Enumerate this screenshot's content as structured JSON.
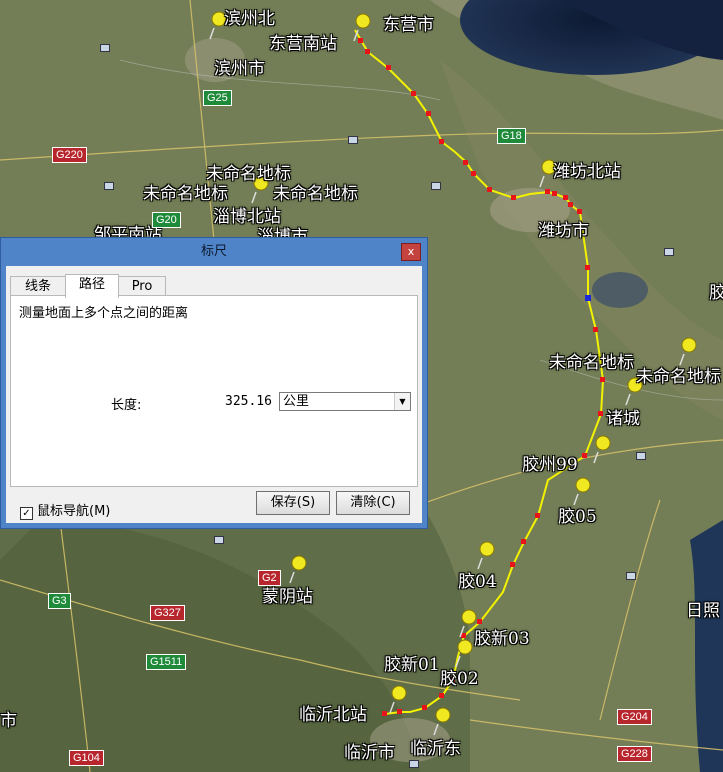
{
  "map": {
    "places": [
      {
        "text": "滨州北"
      },
      {
        "text": "东营市"
      },
      {
        "text": "东营南站"
      },
      {
        "text": "滨州市"
      },
      {
        "text": "潍坊北站"
      },
      {
        "text": "未命名地标"
      },
      {
        "text": "未命名地标"
      },
      {
        "text": "未命名地标"
      },
      {
        "text": "淄博北站"
      },
      {
        "text": "邹平南站"
      },
      {
        "text": "淄博市"
      },
      {
        "text": "潍坊市"
      },
      {
        "text": "胶"
      },
      {
        "text": "未命名地标"
      },
      {
        "text": "未命名地标"
      },
      {
        "text": "诸城"
      },
      {
        "text": "胶州99"
      },
      {
        "text": "胶05"
      },
      {
        "text": "胶04"
      },
      {
        "text": "蒙阴站"
      },
      {
        "text": "胶新03"
      },
      {
        "text": "日照"
      },
      {
        "text": "胶新01"
      },
      {
        "text": "胶02"
      },
      {
        "text": "临沂北站"
      },
      {
        "text": "临沂市"
      },
      {
        "text": "临沂东"
      },
      {
        "text": "市"
      }
    ],
    "shields": [
      {
        "text": "G25",
        "color": "green"
      },
      {
        "text": "G220",
        "color": "red"
      },
      {
        "text": "G18",
        "color": "green"
      },
      {
        "text": "G20",
        "color": "green"
      },
      {
        "text": "G3",
        "color": "green"
      },
      {
        "text": "G327",
        "color": "red"
      },
      {
        "text": "G2",
        "color": "red"
      },
      {
        "text": "G1511",
        "color": "green"
      },
      {
        "text": "G204",
        "color": "red"
      },
      {
        "text": "G104",
        "color": "red"
      },
      {
        "text": "G228",
        "color": "red"
      }
    ]
  },
  "dialog": {
    "title": "标尺",
    "close": "x",
    "tabs": [
      "线条",
      "路径",
      "Pro"
    ],
    "active_tab": "路径",
    "description": "测量地面上多个点之间的距离",
    "length_label": "长度:",
    "length_value": "325.16",
    "unit": "公里",
    "mouse_nav_checked": true,
    "mouse_nav_label": "鼠标导航(M)",
    "save_label": "保存(S)",
    "clear_label": "清除(C)"
  },
  "colors": {
    "path": "#f2f200",
    "point": "#e8141a",
    "selected_point": "#1c2ad8",
    "titlebar": "#4f84c8"
  }
}
